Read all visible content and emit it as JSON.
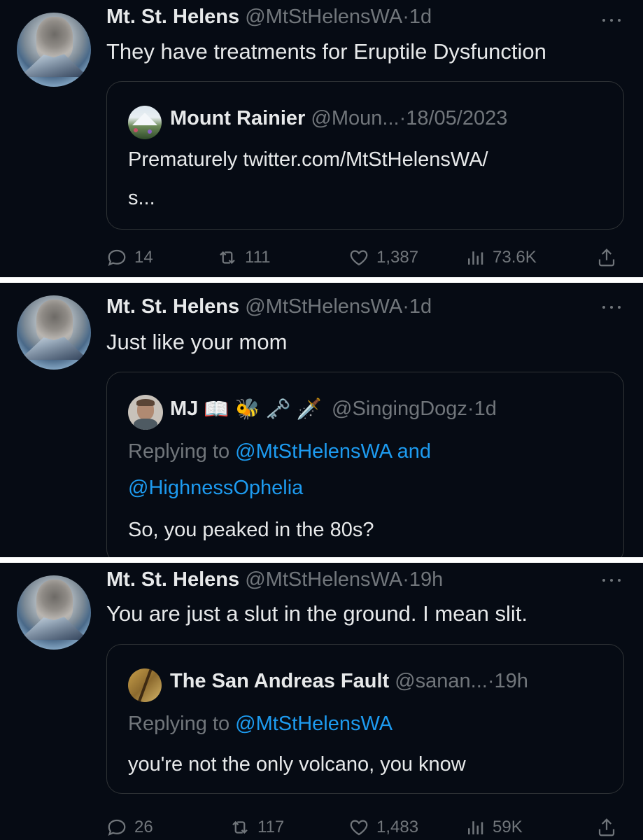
{
  "tweets": [
    {
      "author_name": "Mt. St. Helens",
      "author_handle": "@MtStHelensWA",
      "time_sep": "·",
      "time": "1d",
      "text": "They have treatments for Eruptile Dysfunction",
      "quote": {
        "name": "Mount Rainier",
        "handle": "@Moun...",
        "time_sep": "·",
        "time": "18/05/2023",
        "line1": "Prematurely twitter.com/MtStHelensWA/",
        "line2": "s..."
      },
      "actions": {
        "replies": "14",
        "retweets": "111",
        "likes": "1,387",
        "views": "73.6K"
      }
    },
    {
      "author_name": "Mt. St. Helens",
      "author_handle": "@MtStHelensWA",
      "time_sep": "·",
      "time": "1d",
      "text": "Just like your mom",
      "quote": {
        "name": "MJ",
        "emojis": "📖 🐝 🗝️ 🗡️",
        "handle": "@SingingDogz",
        "time_sep": "·",
        "time": "1d",
        "replying_prefix": "Replying to",
        "mention1": "@MtStHelensWA",
        "and_word": "and",
        "mention2": "@HighnessOphelia",
        "body": "So, you peaked in the 80s?"
      }
    },
    {
      "author_name": "Mt. St. Helens",
      "author_handle": "@MtStHelensWA",
      "time_sep": "·",
      "time": "19h",
      "text": "You are just a slut in the ground. I mean slit.",
      "quote": {
        "name": "The San Andreas Fault",
        "handle": "@sanan...",
        "time_sep": "·",
        "time": "19h",
        "replying_prefix": "Replying to",
        "mention1": "@MtStHelensWA",
        "body": "you're not the only volcano, you know"
      },
      "actions": {
        "replies": "26",
        "retweets": "117",
        "likes": "1,483",
        "views": "59K"
      }
    }
  ],
  "colors": {
    "background": "#060b14",
    "text": "#e7e9ea",
    "muted": "#71767b",
    "link": "#1d9bf0",
    "border": "#2f3336"
  }
}
